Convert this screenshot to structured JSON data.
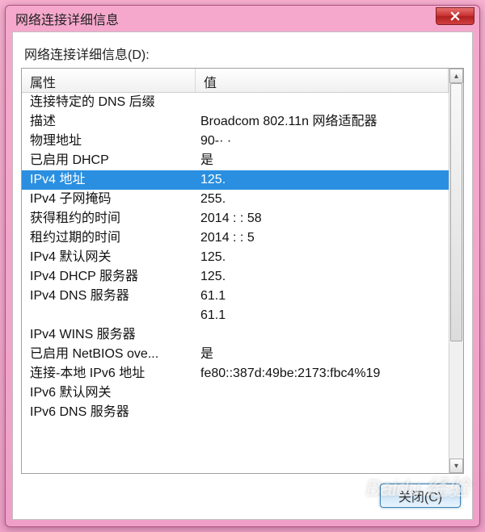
{
  "window": {
    "title": "网络连接详细信息"
  },
  "section_label": "网络连接详细信息(D):",
  "columns": {
    "property": "属性",
    "value": "值"
  },
  "rows": [
    {
      "prop": "连接特定的 DNS 后缀",
      "val": ""
    },
    {
      "prop": "描述",
      "val": "Broadcom 802.11n 网络适配器"
    },
    {
      "prop": "物理地址",
      "val": "90-· ·"
    },
    {
      "prop": "已启用 DHCP",
      "val": "是"
    },
    {
      "prop": "IPv4 地址",
      "val": "125.",
      "selected": true
    },
    {
      "prop": "IPv4 子网掩码",
      "val": "255."
    },
    {
      "prop": "获得租约的时间",
      "val": "2014            :   : 58"
    },
    {
      "prop": "租约过期的时间",
      "val": "2014            :   : 5"
    },
    {
      "prop": "IPv4 默认网关",
      "val": "125."
    },
    {
      "prop": "IPv4 DHCP 服务器",
      "val": "125."
    },
    {
      "prop": "IPv4 DNS 服务器",
      "val": "61.1"
    },
    {
      "prop": "",
      "val": "61.1"
    },
    {
      "prop": "IPv4 WINS 服务器",
      "val": ""
    },
    {
      "prop": "已启用 NetBIOS ove...",
      "val": "是"
    },
    {
      "prop": "连接-本地 IPv6 地址",
      "val": "fe80::387d:49be:2173:fbc4%19"
    },
    {
      "prop": "IPv6 默认网关",
      "val": ""
    },
    {
      "prop": "IPv6 DNS 服务器",
      "val": ""
    }
  ],
  "buttons": {
    "close": "关闭(C)"
  },
  "watermark": "Baidu 经验"
}
